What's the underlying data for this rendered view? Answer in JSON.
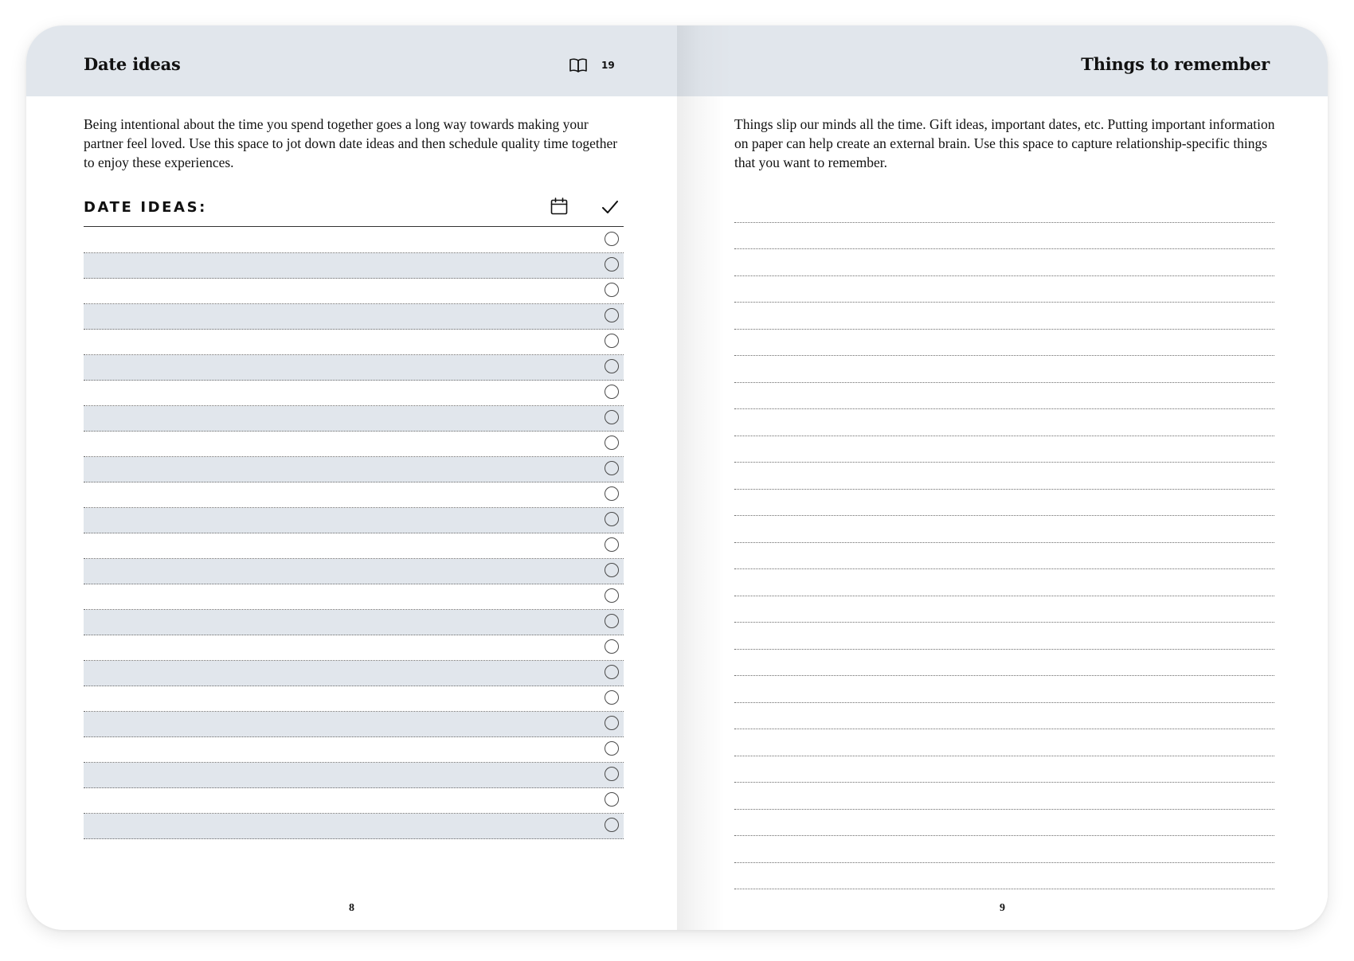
{
  "left_page": {
    "title": "Date ideas",
    "page_ref": "19",
    "intro": "Being intentional about the time you spend together goes a long way towards making your partner feel loved. Use this space to jot down date ideas and then schedule quality time together to enjoy these experiences.",
    "section_label": "DATE IDEAS:",
    "page_number": "8",
    "icons": [
      "book-icon",
      "calendar-icon",
      "checkmark-icon",
      "checkbox-circle-icon"
    ]
  },
  "right_page": {
    "title": "Things to remember",
    "intro": "Things slip our minds all the time. Gift ideas, important dates, etc. Putting important information on paper can help create an external brain. Use this space to capture relationship-specific things that you want to remember.",
    "page_number": "9"
  },
  "colors": {
    "header_band": "#e1e6ec",
    "row_shade": "#e1e6ec",
    "text": "#111111",
    "rule": "#333333"
  }
}
